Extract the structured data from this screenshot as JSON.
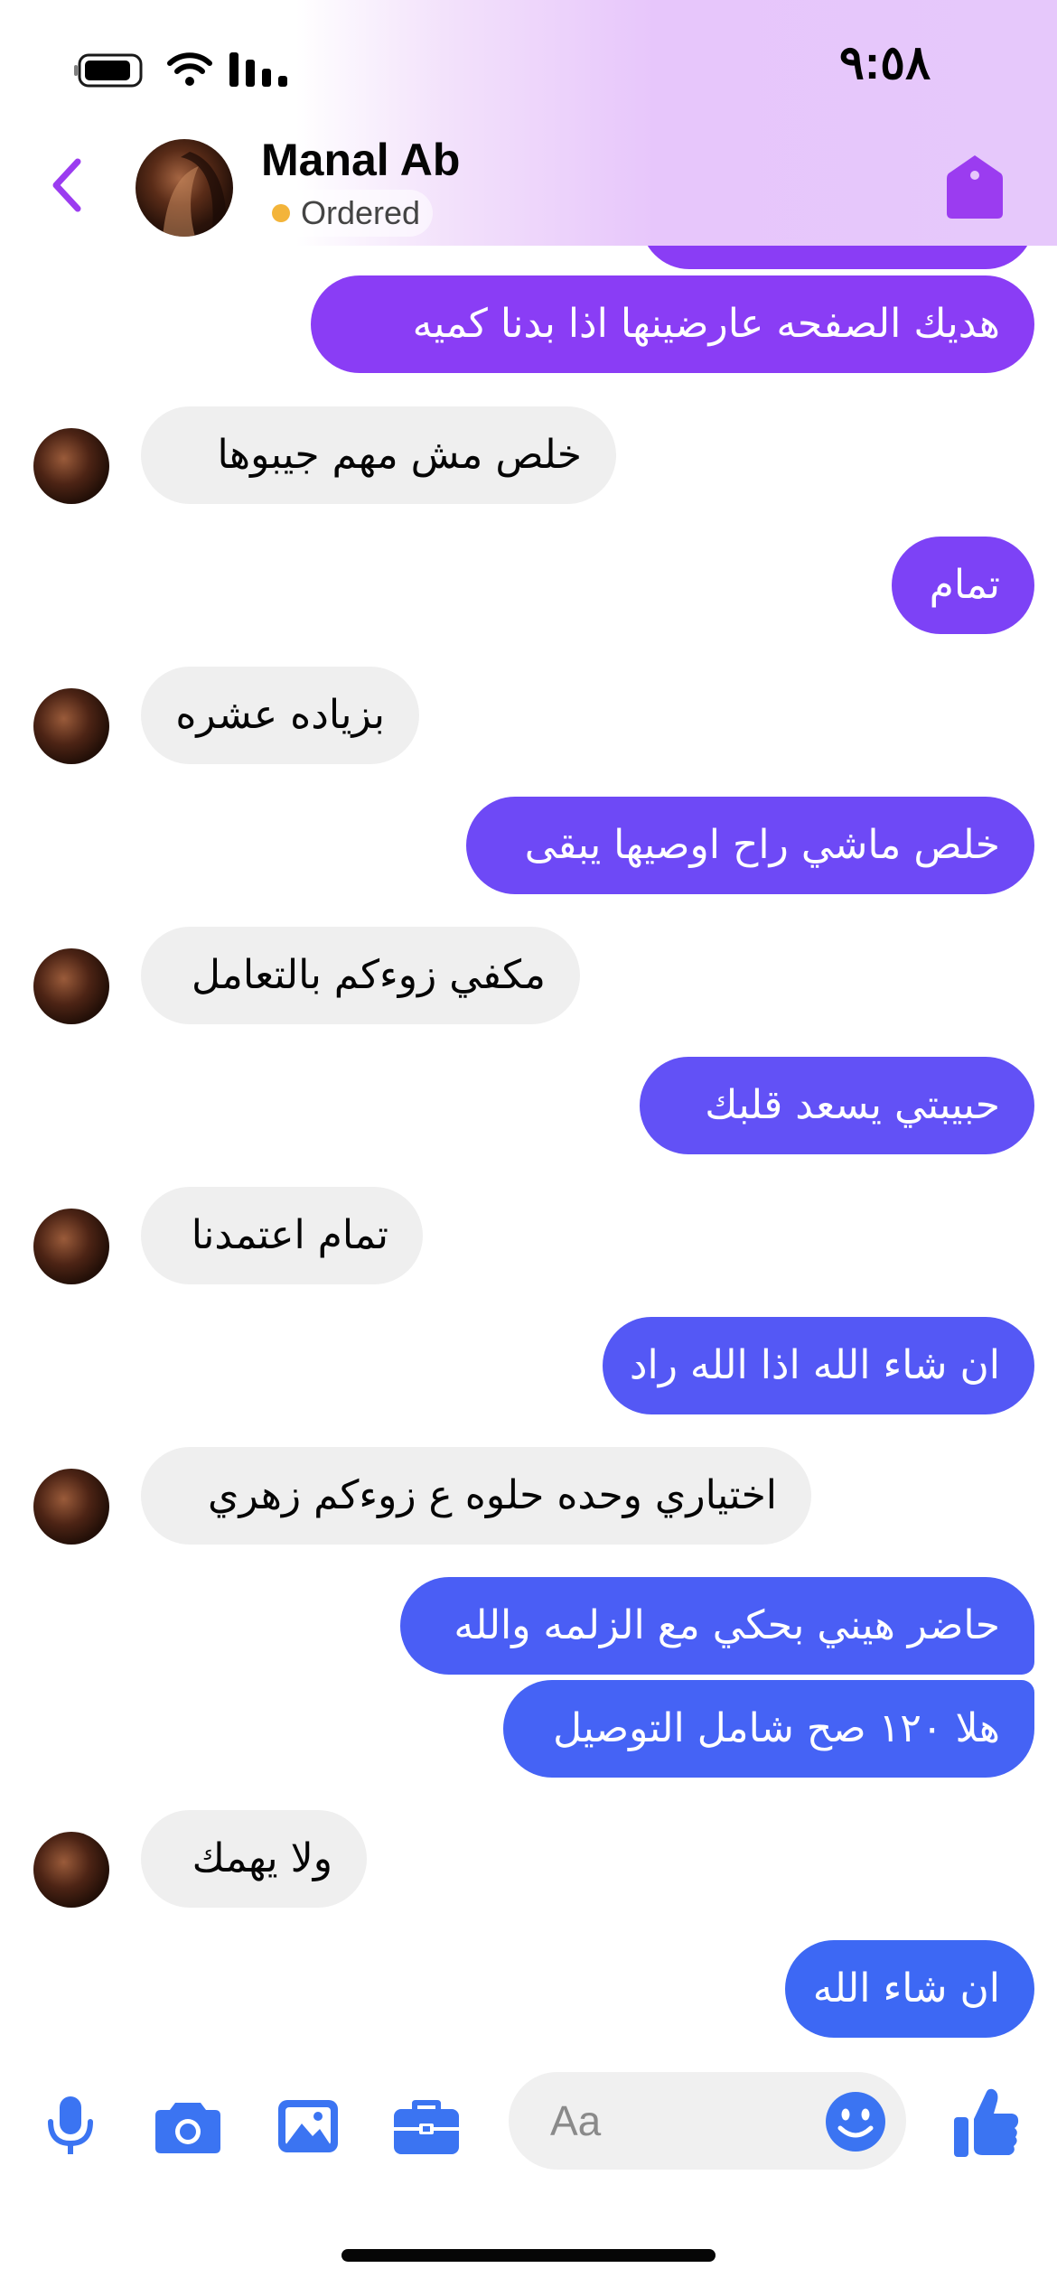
{
  "status_bar": {
    "time": "٩:٥٨"
  },
  "header": {
    "contact_name": "Manal Ab",
    "status_label": "Ordered",
    "status_color": "#f3b43a",
    "accent_color": "#9b3cf0",
    "icons": [
      "back-chevron-icon",
      "tag-icon"
    ]
  },
  "messages": [
    {
      "side": "out",
      "text": "",
      "color": "#8a3df5"
    },
    {
      "side": "out",
      "text": "هديك الصفحه عارضينها اذا بدنا كميه",
      "color": "#8a3df5"
    },
    {
      "side": "in",
      "text": "خلص مش مهم جيبوها"
    },
    {
      "side": "out",
      "text": "تمام",
      "color": "#7d42f6"
    },
    {
      "side": "in",
      "text": "بزياده عشره"
    },
    {
      "side": "out",
      "text": "خلص ماشي راح اوصيها يبقى",
      "color": "#6e49f6"
    },
    {
      "side": "in",
      "text": "مكفي زوءكم بالتعامل"
    },
    {
      "side": "out",
      "text": "حبيبتي يسعد قلبك",
      "color": "#6251f6"
    },
    {
      "side": "in",
      "text": "تمام اعتمدنا"
    },
    {
      "side": "out",
      "text": "ان شاء الله اذا الله راد",
      "color": "#5458f5"
    },
    {
      "side": "in",
      "text": "اختياري وحده حلوه ع زوءكم زهري"
    },
    {
      "side": "out",
      "text": "حاضر هيني بحكي مع الزلمه والله",
      "color": "#4a5ef5"
    },
    {
      "side": "out",
      "text": "هلا ١٢٠ صح شامل التوصيل",
      "color": "#4563f5"
    },
    {
      "side": "in",
      "text": "ولا يهمك"
    },
    {
      "side": "out",
      "text": "ان شاء الله",
      "color": "#3d68f4"
    }
  ],
  "composer": {
    "placeholder": "Aa",
    "icon_color": "#3b74f2",
    "icons": [
      "microphone-icon",
      "camera-icon",
      "photo-icon",
      "briefcase-icon",
      "emoji-icon",
      "thumbs-up-icon"
    ]
  }
}
